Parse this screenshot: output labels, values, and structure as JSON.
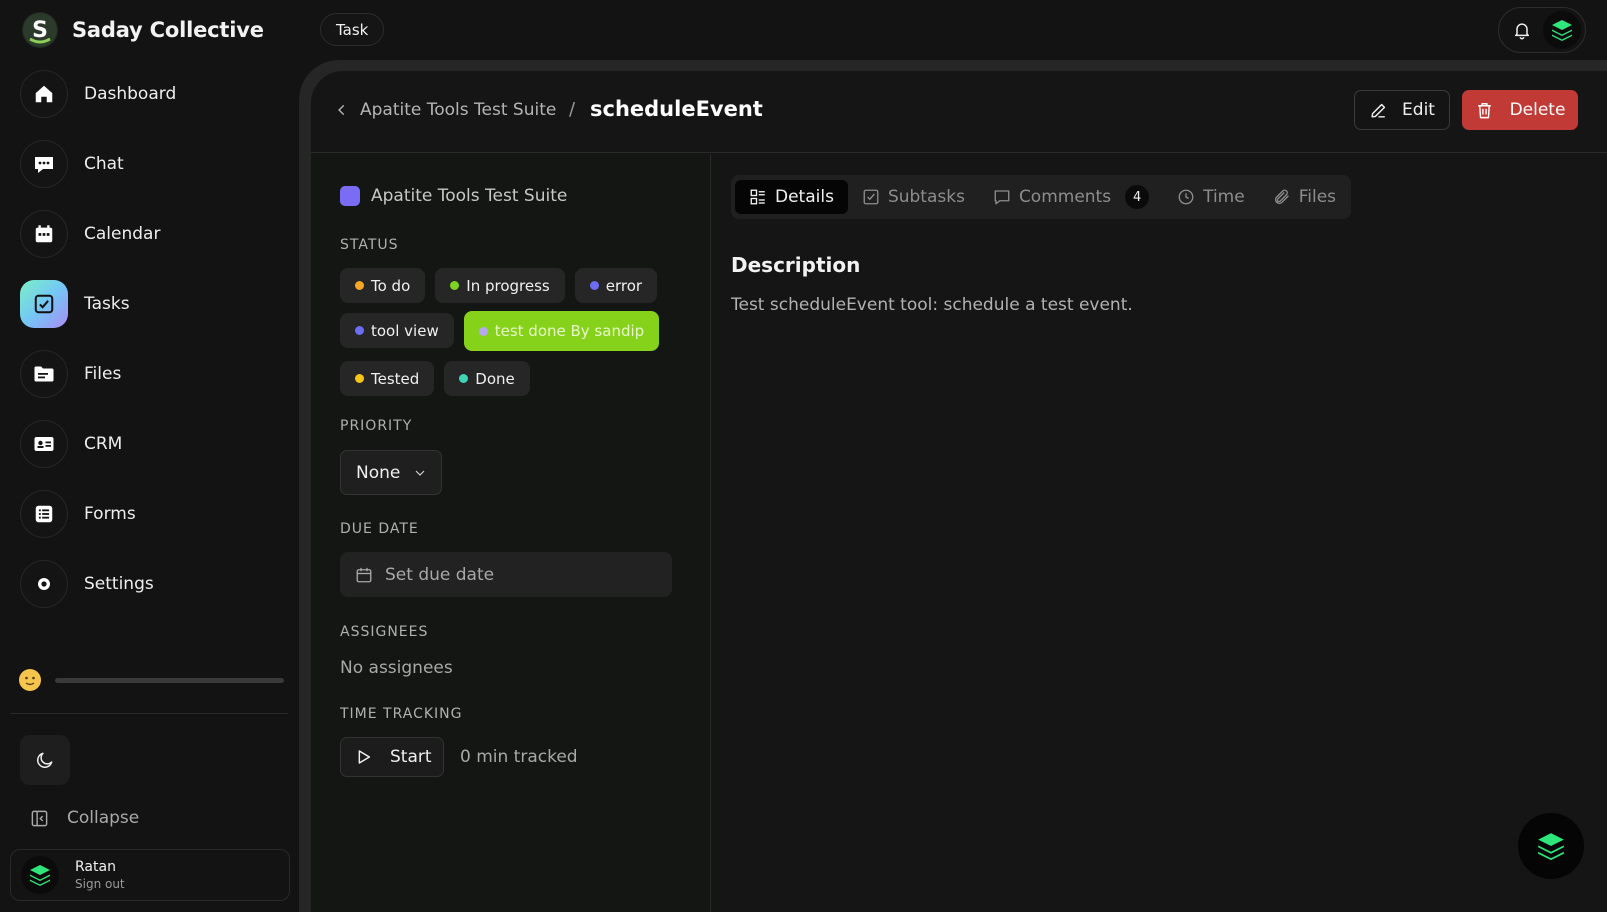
{
  "brand": {
    "name": "Saday Collective"
  },
  "sidebar": {
    "items": [
      {
        "label": "Dashboard",
        "icon": "home-icon"
      },
      {
        "label": "Chat",
        "icon": "chat-icon"
      },
      {
        "label": "Calendar",
        "icon": "calendar-icon"
      },
      {
        "label": "Tasks",
        "icon": "checkbox-icon",
        "active": true
      },
      {
        "label": "Files",
        "icon": "folder-icon"
      },
      {
        "label": "CRM",
        "icon": "id-card-icon"
      },
      {
        "label": "Forms",
        "icon": "list-icon"
      },
      {
        "label": "Settings",
        "icon": "gear-icon"
      }
    ],
    "collapse_label": "Collapse",
    "user": {
      "name": "Ratan",
      "signout": "Sign out"
    }
  },
  "topbar": {
    "chip": "Task"
  },
  "header": {
    "parent": "Apatite Tools Test Suite",
    "separator": "/",
    "title": "scheduleEvent",
    "edit_label": "Edit",
    "delete_label": "Delete"
  },
  "task": {
    "project": {
      "name": "Apatite Tools Test Suite",
      "color": "#7b6cf6"
    },
    "status_label": "STATUS",
    "statuses": [
      {
        "label": "To do",
        "color": "#f5a623"
      },
      {
        "label": "In progress",
        "color": "#7ed321"
      },
      {
        "label": "error",
        "color": "#6c6cf6"
      },
      {
        "label": "tool view",
        "color": "#6c6cf6"
      },
      {
        "label": "test done By sandip",
        "color": "#b7a7f0",
        "active": true
      },
      {
        "label": "Tested",
        "color": "#f5c518"
      },
      {
        "label": "Done",
        "color": "#3fd3b8"
      }
    ],
    "priority_label": "PRIORITY",
    "priority_value": "None",
    "due_label": "DUE DATE",
    "due_placeholder": "Set due date",
    "assignees_label": "ASSIGNEES",
    "assignees_empty": "No assignees",
    "time_label": "TIME TRACKING",
    "start_label": "Start",
    "tracked": "0 min tracked"
  },
  "tabs": [
    {
      "label": "Details",
      "icon": "details-icon",
      "active": true
    },
    {
      "label": "Subtasks",
      "icon": "checkbox-icon"
    },
    {
      "label": "Comments",
      "icon": "comment-icon",
      "badge": "4"
    },
    {
      "label": "Time",
      "icon": "clock-icon"
    },
    {
      "label": "Files",
      "icon": "paperclip-icon"
    }
  ],
  "description": {
    "title": "Description",
    "text": "Test scheduleEvent tool: schedule a test event."
  },
  "colors": {
    "accent": "#86d11a",
    "danger": "#c23a36",
    "brand_green": "#2ee67a"
  }
}
